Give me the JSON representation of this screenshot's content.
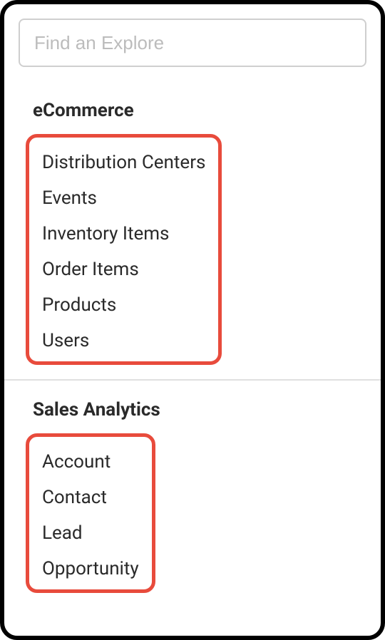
{
  "search": {
    "placeholder": "Find an Explore"
  },
  "sections": [
    {
      "title": "eCommerce",
      "items": [
        "Distribution Centers",
        "Events",
        "Inventory Items",
        "Order Items",
        "Products",
        "Users"
      ]
    },
    {
      "title": "Sales Analytics",
      "items": [
        "Account",
        "Contact",
        "Lead",
        "Opportunity"
      ]
    }
  ]
}
